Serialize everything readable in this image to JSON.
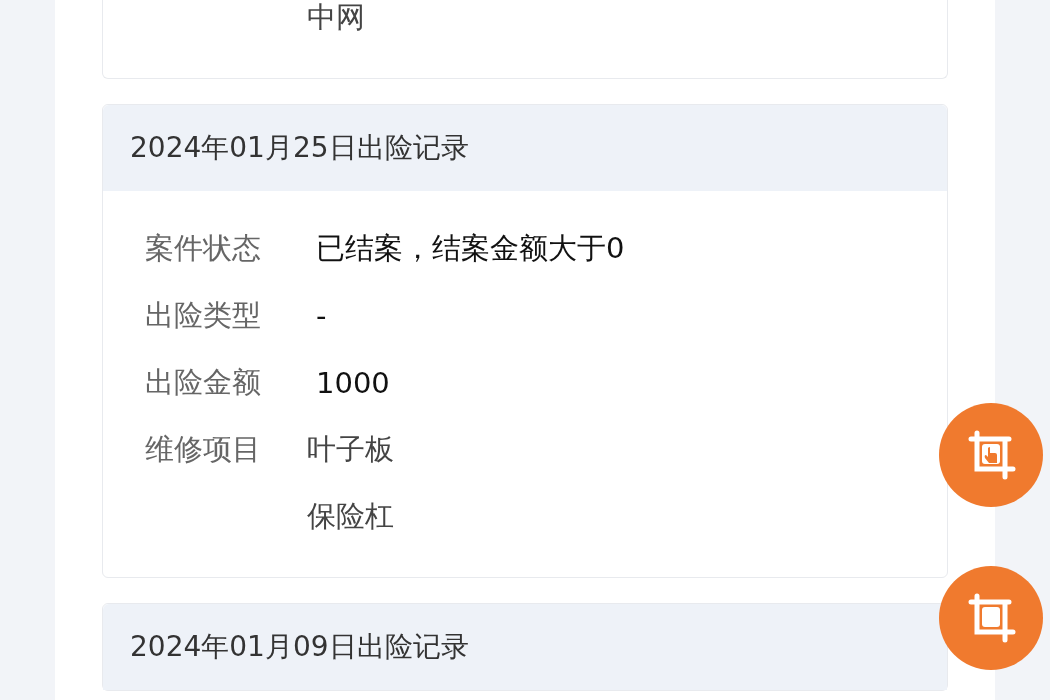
{
  "previous_record": {
    "repair_items": [
      "中网"
    ]
  },
  "records": [
    {
      "title": "2024年01月25日出险记录",
      "fields": [
        {
          "label": "案件状态",
          "value": "已结案，结案金额大于0"
        },
        {
          "label": "出险类型",
          "value": "-"
        },
        {
          "label": "出险金额",
          "value": "1000"
        }
      ],
      "repair_label": "维修项目",
      "repair_items": [
        "叶子板",
        "保险杠"
      ]
    },
    {
      "title": "2024年01月09日出险记录"
    }
  ],
  "floating_buttons": [
    {
      "kind": "touch"
    },
    {
      "kind": "crop"
    }
  ]
}
